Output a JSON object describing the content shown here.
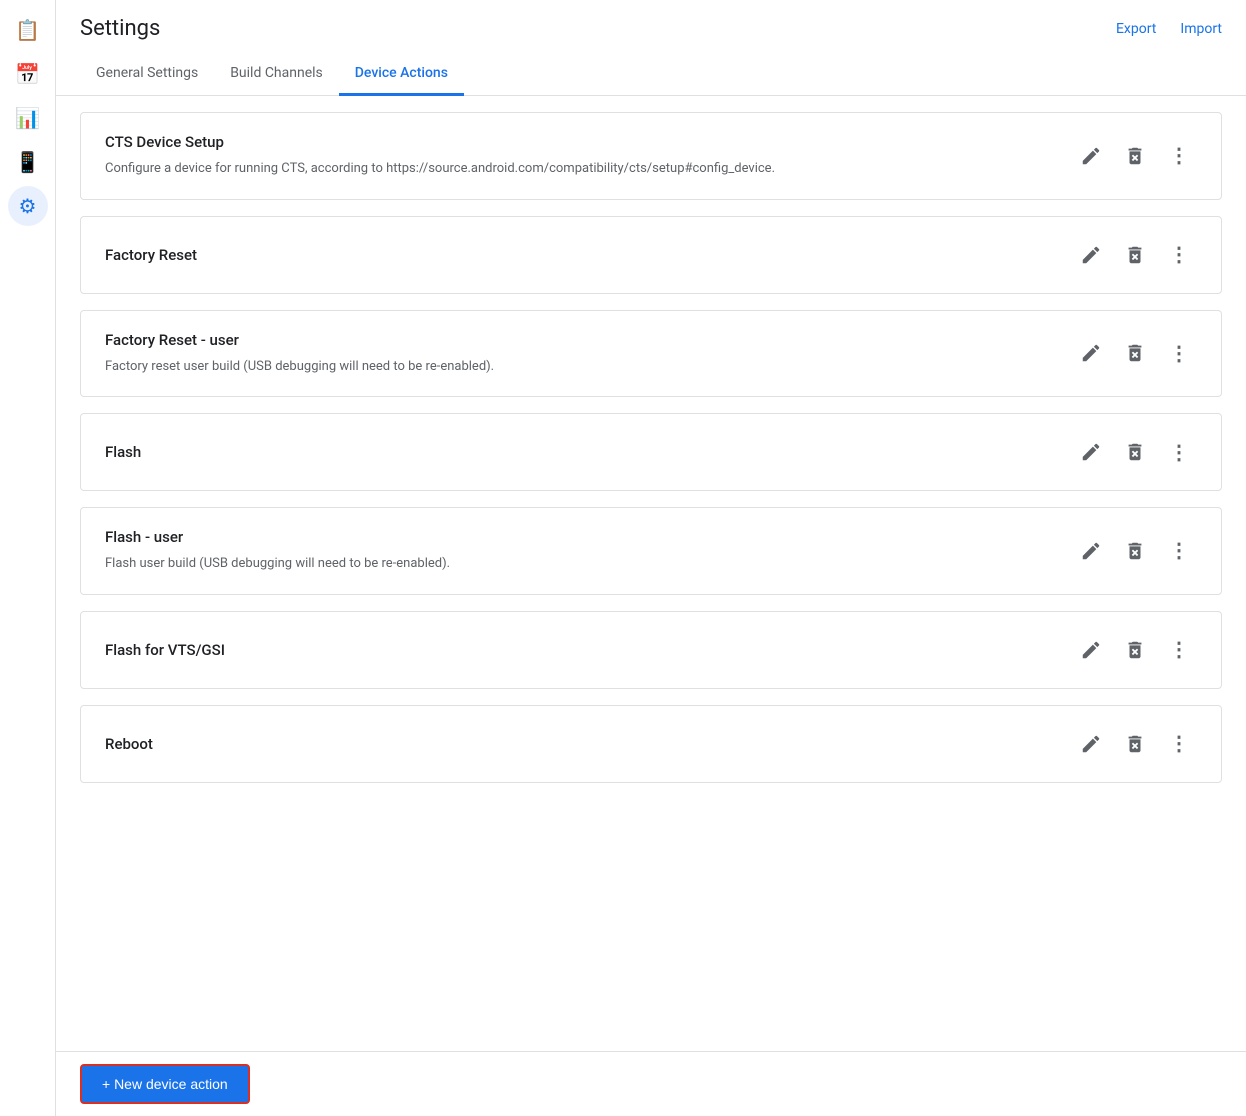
{
  "page": {
    "title": "Settings",
    "export_label": "Export",
    "import_label": "Import"
  },
  "sidebar": {
    "items": [
      {
        "id": "clipboard",
        "label": "Clipboard",
        "icon": "📋"
      },
      {
        "id": "calendar",
        "label": "Calendar",
        "icon": "📅"
      },
      {
        "id": "chart",
        "label": "Chart",
        "icon": "📊"
      },
      {
        "id": "device",
        "label": "Device",
        "icon": "📱"
      },
      {
        "id": "settings",
        "label": "Settings",
        "icon": "⚙",
        "active": true
      }
    ]
  },
  "tabs": [
    {
      "id": "general",
      "label": "General Settings",
      "active": false
    },
    {
      "id": "build",
      "label": "Build Channels",
      "active": false
    },
    {
      "id": "device-actions",
      "label": "Device Actions",
      "active": true
    }
  ],
  "device_actions": [
    {
      "id": "cts-device-setup",
      "title": "CTS Device Setup",
      "description": "Configure a device for running CTS, according to https://source.android.com/compatibility/cts/setup#config_device."
    },
    {
      "id": "factory-reset",
      "title": "Factory Reset",
      "description": ""
    },
    {
      "id": "factory-reset-user",
      "title": "Factory Reset - user",
      "description": "Factory reset user build (USB debugging will need to be re-enabled)."
    },
    {
      "id": "flash",
      "title": "Flash",
      "description": ""
    },
    {
      "id": "flash-user",
      "title": "Flash - user",
      "description": "Flash user build (USB debugging will need to be re-enabled)."
    },
    {
      "id": "flash-vts-gsi",
      "title": "Flash for VTS/GSI",
      "description": ""
    },
    {
      "id": "reboot",
      "title": "Reboot",
      "description": ""
    }
  ],
  "footer": {
    "new_action_label": "+ New device action"
  },
  "icons": {
    "edit": "✏",
    "delete": "🗑",
    "more": "⋮"
  }
}
